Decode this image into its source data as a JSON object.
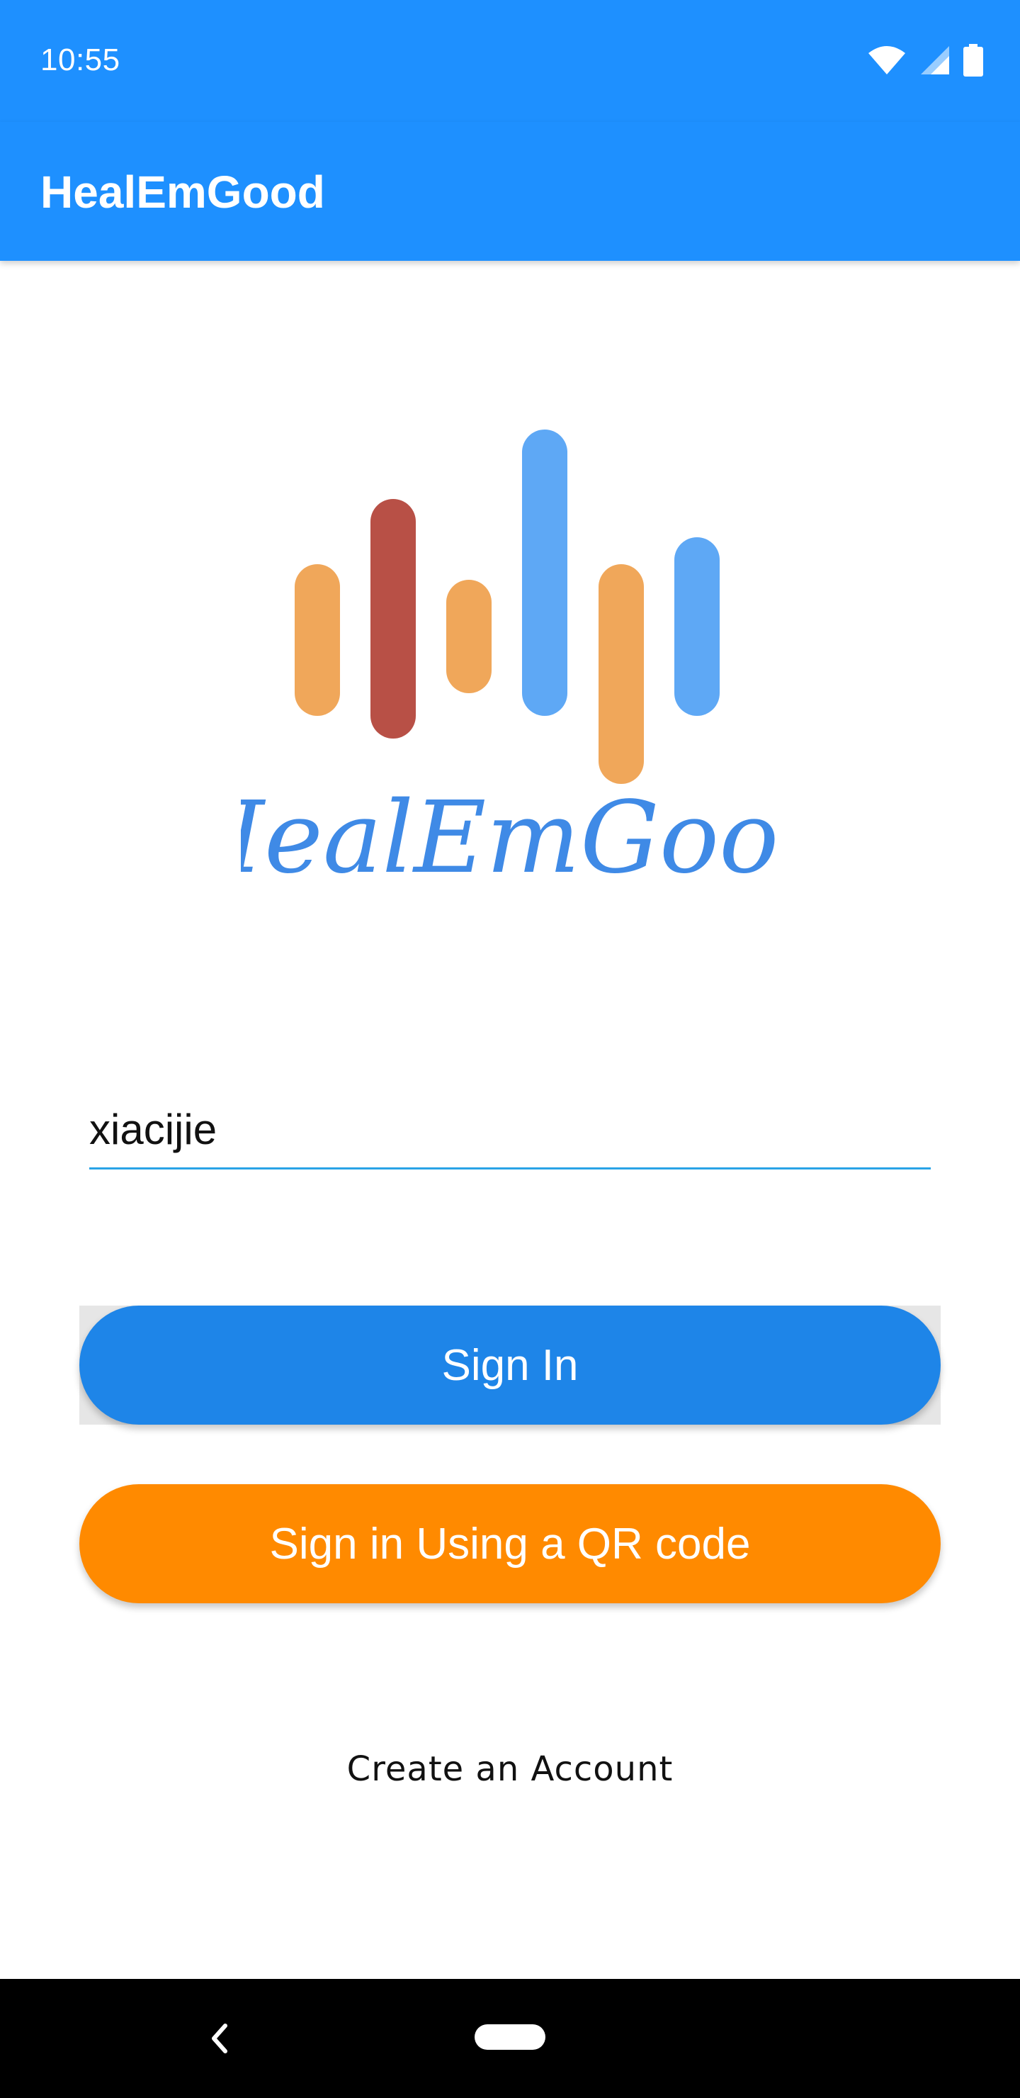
{
  "status_bar": {
    "time": "10:55",
    "icons": [
      "wifi-icon",
      "signal-icon",
      "battery-icon"
    ]
  },
  "app_bar": {
    "title": "HealEmGood"
  },
  "logo": {
    "text": "HealEmGood",
    "colors": {
      "orange": "#f0a75a",
      "red": "#b85046",
      "blue": "#5ea8f5",
      "script": "#3f8ae6"
    }
  },
  "form": {
    "username_value": "xiacijie"
  },
  "buttons": {
    "sign_in_label": "Sign In",
    "qr_label": "Sign in Using a QR code",
    "sign_in_color": "#1e85e8",
    "qr_color": "#ff8a00"
  },
  "links": {
    "create_account": "Create an Account"
  },
  "nav": {
    "icons": [
      "back-icon",
      "home-pill-icon"
    ]
  },
  "theme": {
    "primary": "#1e90ff"
  }
}
